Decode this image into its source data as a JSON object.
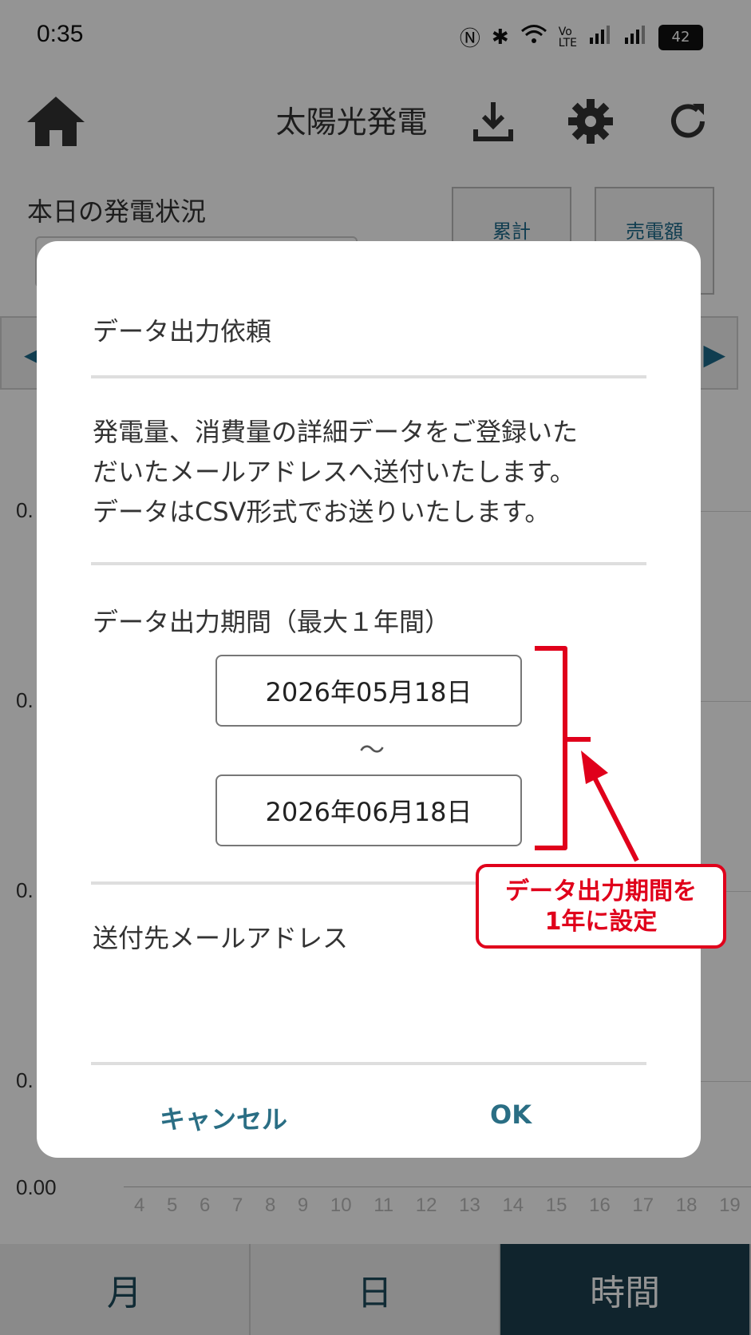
{
  "status_bar": {
    "time": "0:35",
    "battery": "42"
  },
  "app_bar": {
    "title": "太陽光発電"
  },
  "content": {
    "label": "本日の発電状況",
    "buttons": [
      "累計",
      "売電額"
    ],
    "y_labels": [
      "0.",
      "0.",
      "0.",
      "0.",
      "0.00"
    ],
    "x_labels": [
      "4",
      "5",
      "6",
      "7",
      "8",
      "9",
      "10",
      "11",
      "12",
      "13",
      "14",
      "15",
      "16",
      "17",
      "18",
      "19"
    ]
  },
  "tabs": [
    "月",
    "日",
    "時間"
  ],
  "dialog": {
    "title": "データ出力依頼",
    "body": [
      "発電量、消費量の詳細データをご登録いた",
      "だいたメールアドレスへ送付いたします。",
      "データはCSV形式でお送りいたします。"
    ],
    "period_label": "データ出力期間（最大１年間）",
    "start_date": "2026年05月18日",
    "separator": "〜",
    "end_date": "2026年06月18日",
    "mail_label": "送付先メールアドレス",
    "cancel_label": "キャンセル",
    "ok_label": "OK"
  },
  "annotation": {
    "line1": "データ出力期間を",
    "line2": "1年に設定",
    "color": "#e0001b"
  }
}
